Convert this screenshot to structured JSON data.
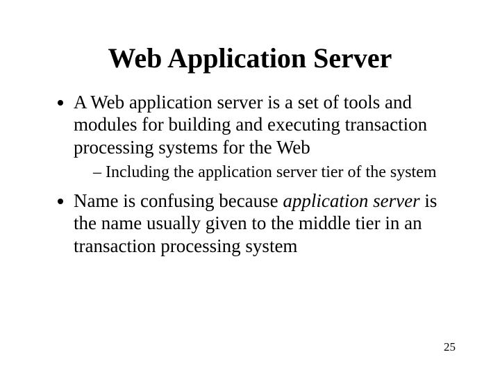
{
  "title": "Web Application Server",
  "bullets": {
    "b1": "A Web application server is a set of tools and modules for building and executing transaction processing systems for the Web",
    "b1_sub1": "Including the application server tier of the system",
    "b2_part1": "Name is confusing because ",
    "b2_italic": "application server",
    "b2_part2": " is the name usually given to the middle tier in an transaction processing system"
  },
  "page_number": "25"
}
